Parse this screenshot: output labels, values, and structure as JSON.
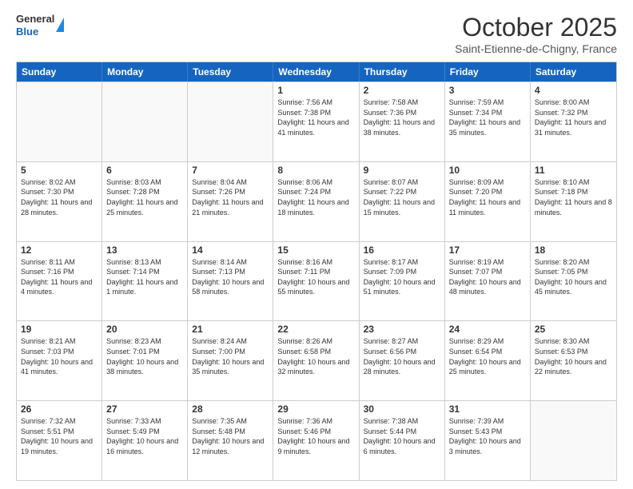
{
  "header": {
    "logo": {
      "general": "General",
      "blue": "Blue"
    },
    "title": "October 2025",
    "location": "Saint-Etienne-de-Chigny, France"
  },
  "calendar": {
    "weekdays": [
      "Sunday",
      "Monday",
      "Tuesday",
      "Wednesday",
      "Thursday",
      "Friday",
      "Saturday"
    ],
    "rows": [
      [
        {
          "day": "",
          "empty": true
        },
        {
          "day": "",
          "empty": true
        },
        {
          "day": "",
          "empty": true
        },
        {
          "day": "1",
          "sunrise": "7:56 AM",
          "sunset": "7:38 PM",
          "daylight": "11 hours and 41 minutes."
        },
        {
          "day": "2",
          "sunrise": "7:58 AM",
          "sunset": "7:36 PM",
          "daylight": "11 hours and 38 minutes."
        },
        {
          "day": "3",
          "sunrise": "7:59 AM",
          "sunset": "7:34 PM",
          "daylight": "11 hours and 35 minutes."
        },
        {
          "day": "4",
          "sunrise": "8:00 AM",
          "sunset": "7:32 PM",
          "daylight": "11 hours and 31 minutes."
        }
      ],
      [
        {
          "day": "5",
          "sunrise": "8:02 AM",
          "sunset": "7:30 PM",
          "daylight": "11 hours and 28 minutes."
        },
        {
          "day": "6",
          "sunrise": "8:03 AM",
          "sunset": "7:28 PM",
          "daylight": "11 hours and 25 minutes."
        },
        {
          "day": "7",
          "sunrise": "8:04 AM",
          "sunset": "7:26 PM",
          "daylight": "11 hours and 21 minutes."
        },
        {
          "day": "8",
          "sunrise": "8:06 AM",
          "sunset": "7:24 PM",
          "daylight": "11 hours and 18 minutes."
        },
        {
          "day": "9",
          "sunrise": "8:07 AM",
          "sunset": "7:22 PM",
          "daylight": "11 hours and 15 minutes."
        },
        {
          "day": "10",
          "sunrise": "8:09 AM",
          "sunset": "7:20 PM",
          "daylight": "11 hours and 11 minutes."
        },
        {
          "day": "11",
          "sunrise": "8:10 AM",
          "sunset": "7:18 PM",
          "daylight": "11 hours and 8 minutes."
        }
      ],
      [
        {
          "day": "12",
          "sunrise": "8:11 AM",
          "sunset": "7:16 PM",
          "daylight": "11 hours and 4 minutes."
        },
        {
          "day": "13",
          "sunrise": "8:13 AM",
          "sunset": "7:14 PM",
          "daylight": "11 hours and 1 minute."
        },
        {
          "day": "14",
          "sunrise": "8:14 AM",
          "sunset": "7:13 PM",
          "daylight": "10 hours and 58 minutes."
        },
        {
          "day": "15",
          "sunrise": "8:16 AM",
          "sunset": "7:11 PM",
          "daylight": "10 hours and 55 minutes."
        },
        {
          "day": "16",
          "sunrise": "8:17 AM",
          "sunset": "7:09 PM",
          "daylight": "10 hours and 51 minutes."
        },
        {
          "day": "17",
          "sunrise": "8:19 AM",
          "sunset": "7:07 PM",
          "daylight": "10 hours and 48 minutes."
        },
        {
          "day": "18",
          "sunrise": "8:20 AM",
          "sunset": "7:05 PM",
          "daylight": "10 hours and 45 minutes."
        }
      ],
      [
        {
          "day": "19",
          "sunrise": "8:21 AM",
          "sunset": "7:03 PM",
          "daylight": "10 hours and 41 minutes."
        },
        {
          "day": "20",
          "sunrise": "8:23 AM",
          "sunset": "7:01 PM",
          "daylight": "10 hours and 38 minutes."
        },
        {
          "day": "21",
          "sunrise": "8:24 AM",
          "sunset": "7:00 PM",
          "daylight": "10 hours and 35 minutes."
        },
        {
          "day": "22",
          "sunrise": "8:26 AM",
          "sunset": "6:58 PM",
          "daylight": "10 hours and 32 minutes."
        },
        {
          "day": "23",
          "sunrise": "8:27 AM",
          "sunset": "6:56 PM",
          "daylight": "10 hours and 28 minutes."
        },
        {
          "day": "24",
          "sunrise": "8:29 AM",
          "sunset": "6:54 PM",
          "daylight": "10 hours and 25 minutes."
        },
        {
          "day": "25",
          "sunrise": "8:30 AM",
          "sunset": "6:53 PM",
          "daylight": "10 hours and 22 minutes."
        }
      ],
      [
        {
          "day": "26",
          "sunrise": "7:32 AM",
          "sunset": "5:51 PM",
          "daylight": "10 hours and 19 minutes."
        },
        {
          "day": "27",
          "sunrise": "7:33 AM",
          "sunset": "5:49 PM",
          "daylight": "10 hours and 16 minutes."
        },
        {
          "day": "28",
          "sunrise": "7:35 AM",
          "sunset": "5:48 PM",
          "daylight": "10 hours and 12 minutes."
        },
        {
          "day": "29",
          "sunrise": "7:36 AM",
          "sunset": "5:46 PM",
          "daylight": "10 hours and 9 minutes."
        },
        {
          "day": "30",
          "sunrise": "7:38 AM",
          "sunset": "5:44 PM",
          "daylight": "10 hours and 6 minutes."
        },
        {
          "day": "31",
          "sunrise": "7:39 AM",
          "sunset": "5:43 PM",
          "daylight": "10 hours and 3 minutes."
        },
        {
          "day": "",
          "empty": true
        }
      ]
    ]
  }
}
